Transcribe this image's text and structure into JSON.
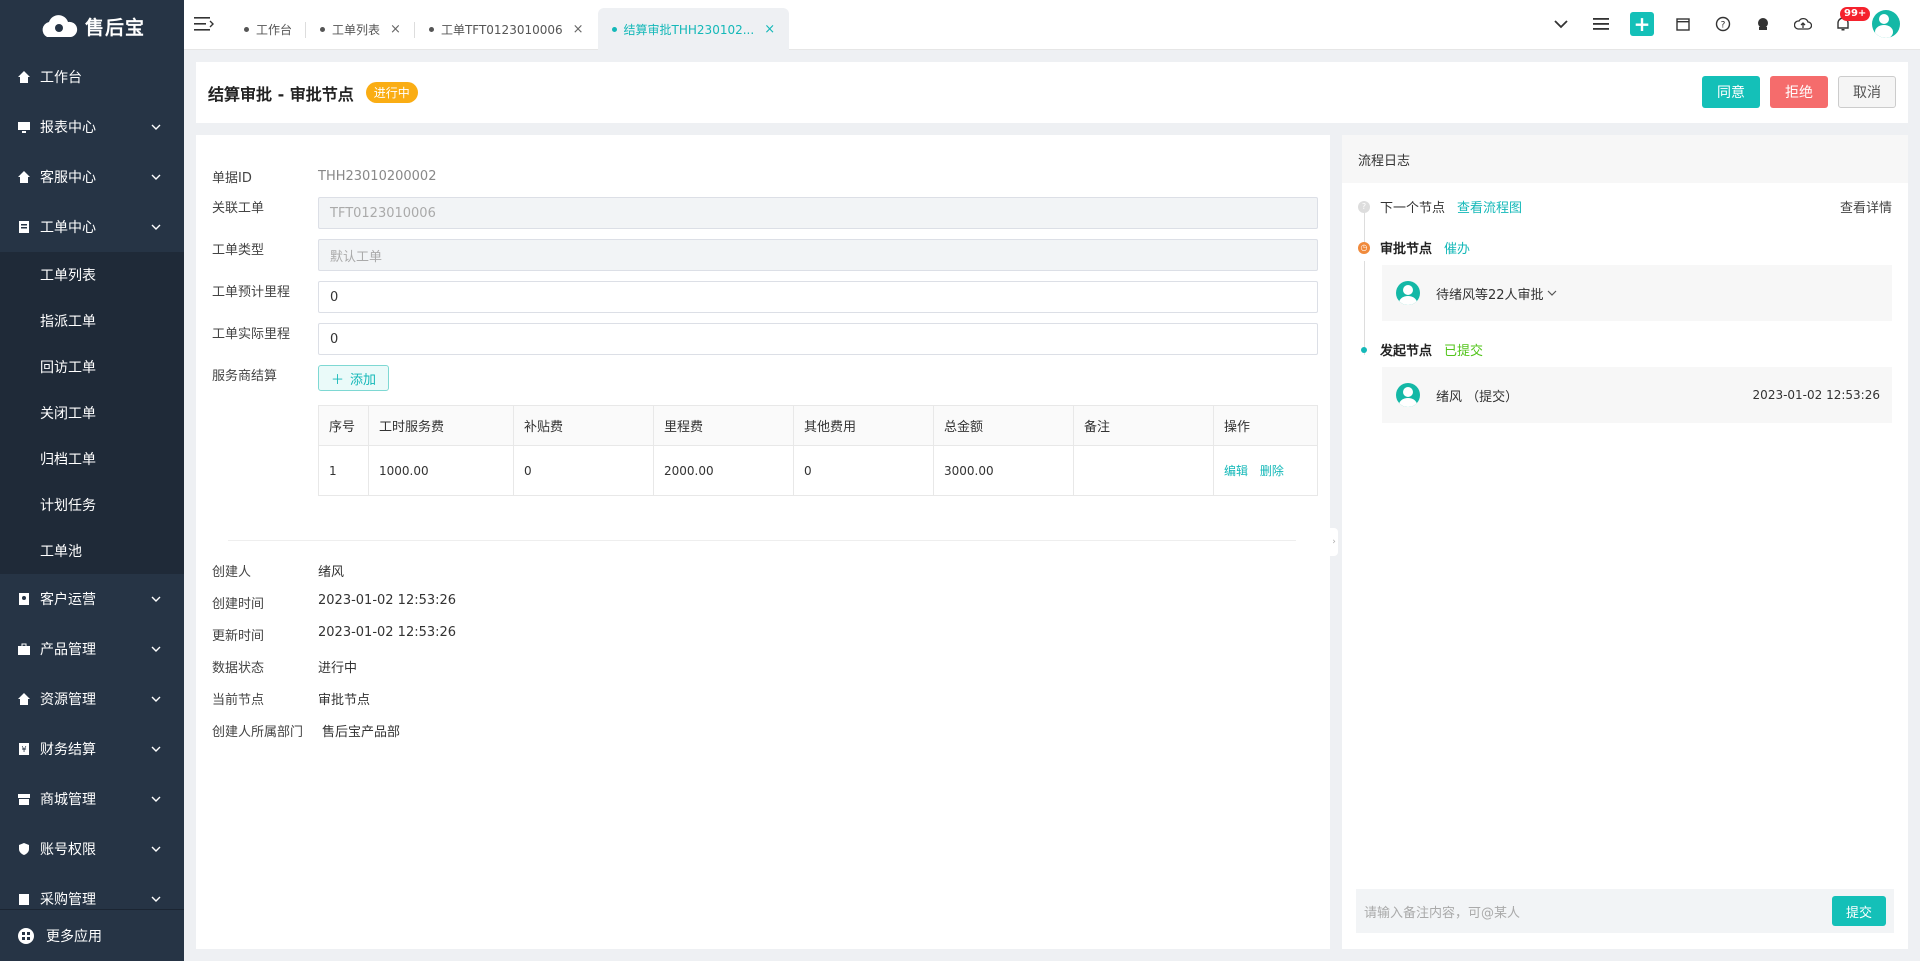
{
  "app": {
    "logo_text": "售后宝",
    "more_apps": "更多应用"
  },
  "sidebar": {
    "items": [
      {
        "label": "工作台",
        "icon": "home-icon"
      },
      {
        "label": "报表中心",
        "icon": "monitor-icon"
      },
      {
        "label": "客服中心",
        "icon": "home-icon"
      },
      {
        "label": "工单中心",
        "icon": "clipboard-icon"
      }
    ],
    "sub_items": [
      "工单列表",
      "指派工单",
      "回访工单",
      "关闭工单",
      "归档工单",
      "计划任务",
      "工单池"
    ],
    "items2": [
      {
        "label": "客户运营",
        "icon": "contact-icon"
      },
      {
        "label": "产品管理",
        "icon": "briefcase-icon"
      },
      {
        "label": "资源管理",
        "icon": "home-icon"
      },
      {
        "label": "财务结算",
        "icon": "ledger-icon"
      },
      {
        "label": "商城管理",
        "icon": "store-icon"
      },
      {
        "label": "账号权限",
        "icon": "shield-icon"
      },
      {
        "label": "采购管理",
        "icon": "cart-icon"
      }
    ]
  },
  "tabs": [
    {
      "label": "工作台"
    },
    {
      "label": "工单列表"
    },
    {
      "label": "工单TFT0123010006"
    },
    {
      "label": "结算审批THH230102..."
    }
  ],
  "top": {
    "badge": "99+"
  },
  "header": {
    "title": "结算审批 - 审批节点",
    "status": "进行中",
    "agree": "同意",
    "reject": "拒绝",
    "cancel": "取消"
  },
  "form": {
    "doc_id_label": "单据ID",
    "doc_id": "THH23010200002",
    "linked_label": "关联工单",
    "linked": "TFT0123010006",
    "type_label": "工单类型",
    "type": "默认工单",
    "est_label": "工单预计里程",
    "est": "0",
    "act_label": "工单实际里程",
    "act": "0",
    "settle_label": "服务商结算",
    "add": "添加"
  },
  "table": {
    "headers": [
      "序号",
      "工时服务费",
      "补贴费",
      "里程费",
      "其他费用",
      "总金额",
      "备注",
      "操作"
    ],
    "rows": [
      {
        "no": "1",
        "labor": "1000.00",
        "subsidy": "0",
        "mileage": "2000.00",
        "other": "0",
        "total": "3000.00",
        "note": "",
        "edit": "编辑",
        "delete": "删除"
      }
    ]
  },
  "info": [
    {
      "label": "创建人",
      "value": "绪风"
    },
    {
      "label": "创建时间",
      "value": "2023-01-02 12:53:26"
    },
    {
      "label": "更新时间",
      "value": "2023-01-02 12:53:26"
    },
    {
      "label": "数据状态",
      "value": "进行中"
    },
    {
      "label": "当前节点",
      "value": "审批节点"
    },
    {
      "label": "创建人所属部门",
      "value": "售后宝产品部"
    }
  ],
  "log": {
    "title": "流程日志",
    "next_node": "下一个节点",
    "view_flow": "查看流程图",
    "view_detail": "查看详情",
    "approve_node": "审批节点",
    "urge": "催办",
    "pending": "待绪风等22人审批",
    "start_node": "发起节点",
    "submitted": "已提交",
    "submitter": "绪风 （提交）",
    "submit_time": "2023-01-02 12:53:26",
    "comment_placeholder": "请输入备注内容，可@某人",
    "submit": "提交"
  },
  "colors": {
    "accent": "#14c0b8",
    "sidebar": "#263445",
    "reject": "#f56c6c",
    "status": "#faad14"
  }
}
